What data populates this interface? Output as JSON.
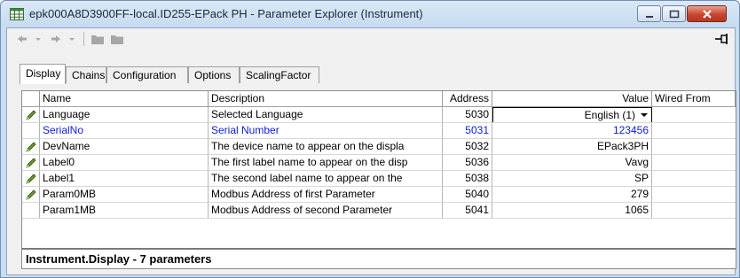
{
  "window": {
    "title": "epk000A8D3900FF-local.ID255-EPack  PH - Parameter Explorer (Instrument)"
  },
  "tabs": [
    {
      "label": "Display",
      "active": true
    },
    {
      "label": "Chains",
      "active": false
    },
    {
      "label": "Configuration",
      "active": false
    },
    {
      "label": "Options",
      "active": false
    },
    {
      "label": "ScalingFactor",
      "active": false
    }
  ],
  "table": {
    "headers": {
      "name": "Name",
      "description": "Description",
      "address": "Address",
      "value": "Value",
      "wired_from": "Wired From"
    },
    "rows": [
      {
        "editable": true,
        "name": "Language",
        "description": "Selected Language",
        "address": "5030",
        "value": "English (1)",
        "wired_from": "",
        "highlight": false,
        "dropdown": true
      },
      {
        "editable": false,
        "name": "SerialNo",
        "description": "Serial Number",
        "address": "5031",
        "value": "123456",
        "wired_from": "",
        "highlight": true,
        "dropdown": false
      },
      {
        "editable": true,
        "name": "DevName",
        "description": "The device name to appear on the displa",
        "address": "5032",
        "value": "EPack3PH",
        "wired_from": "",
        "highlight": false,
        "dropdown": false
      },
      {
        "editable": true,
        "name": "Label0",
        "description": "The first label name to appear on the disp",
        "address": "5036",
        "value": "Vavg",
        "wired_from": "",
        "highlight": false,
        "dropdown": false
      },
      {
        "editable": true,
        "name": "Label1",
        "description": "The second label name to appear on the",
        "address": "5038",
        "value": "SP",
        "wired_from": "",
        "highlight": false,
        "dropdown": false
      },
      {
        "editable": true,
        "name": "Param0MB",
        "description": "Modbus Address of first Parameter",
        "address": "5040",
        "value": "279",
        "wired_from": "",
        "highlight": false,
        "dropdown": false
      },
      {
        "editable": false,
        "name": "Param1MB",
        "description": "Modbus Address of second Parameter",
        "address": "5041",
        "value": "1065",
        "wired_from": "",
        "highlight": false,
        "dropdown": false
      }
    ]
  },
  "status": {
    "text": "Instrument.Display  -  7 parameters"
  },
  "colors": {
    "highlight_text": "#1020d8",
    "title_bar": "#c6daf0",
    "close_button": "#c9452e"
  }
}
